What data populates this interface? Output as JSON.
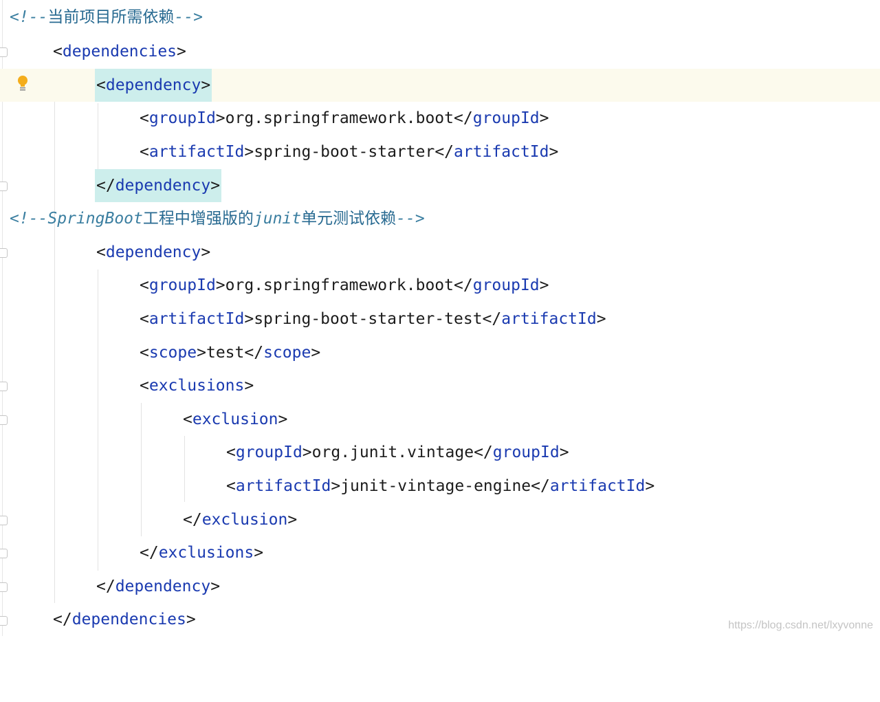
{
  "editor": {
    "lines": [
      {
        "kind": "comment",
        "open": "<!--",
        "text": "当前项目所需依赖",
        "close": "-->"
      },
      {
        "kind": "open",
        "tag": "dependencies"
      },
      {
        "kind": "open",
        "tag": "dependency",
        "highlight": true
      },
      {
        "kind": "element",
        "tag": "groupId",
        "value": "org.springframework.boot"
      },
      {
        "kind": "element",
        "tag": "artifactId",
        "value": "spring-boot-starter"
      },
      {
        "kind": "close",
        "tag": "dependency",
        "highlight": true
      },
      {
        "kind": "comment",
        "open": "<!--",
        "segments": [
          "SpringBoot",
          "工程中增强版的",
          "junit",
          "单元测试依赖"
        ],
        "close": "-->"
      },
      {
        "kind": "open",
        "tag": "dependency"
      },
      {
        "kind": "element",
        "tag": "groupId",
        "value": "org.springframework.boot"
      },
      {
        "kind": "element",
        "tag": "artifactId",
        "value": "spring-boot-starter-test"
      },
      {
        "kind": "element",
        "tag": "scope",
        "value": "test"
      },
      {
        "kind": "open",
        "tag": "exclusions"
      },
      {
        "kind": "open",
        "tag": "exclusion"
      },
      {
        "kind": "element",
        "tag": "groupId",
        "value": "org.junit.vintage"
      },
      {
        "kind": "element",
        "tag": "artifactId",
        "value": "junit-vintage-engine"
      },
      {
        "kind": "close",
        "tag": "exclusion"
      },
      {
        "kind": "close",
        "tag": "exclusions"
      },
      {
        "kind": "close",
        "tag": "dependency"
      },
      {
        "kind": "close",
        "tag": "dependencies"
      }
    ],
    "intention_icon": "lightbulb-icon",
    "colors": {
      "tag": "#1a3ab0",
      "comment": "#3a7ea0",
      "text": "#1c1c1c",
      "highlight": "#cdeeec",
      "current_line": "#fcfaed"
    }
  },
  "watermark": "https://blog.csdn.net/lxyvonne"
}
